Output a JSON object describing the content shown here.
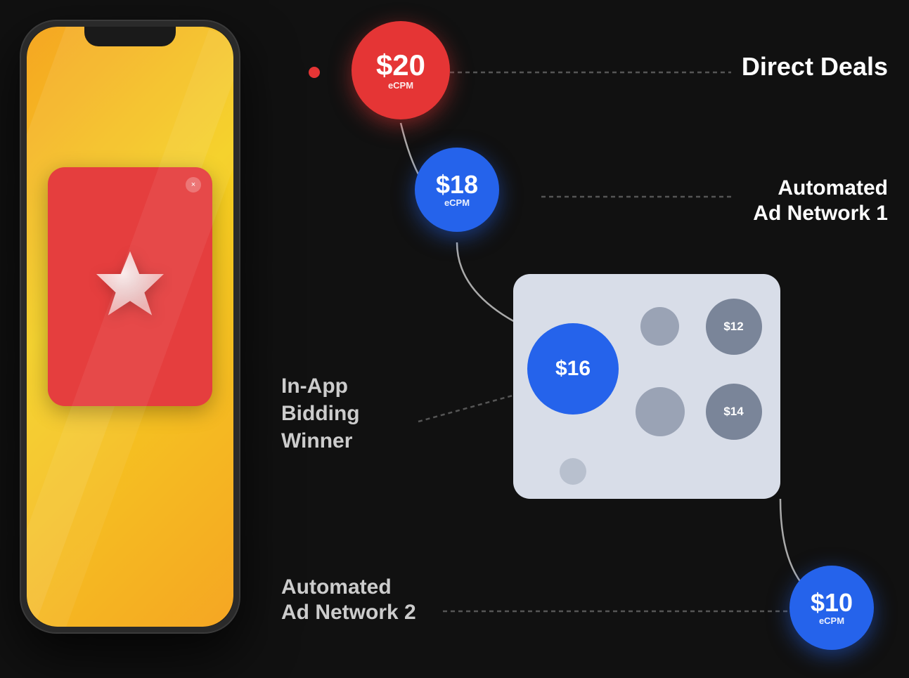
{
  "background": "#111111",
  "phone": {
    "ad_card": {
      "close_symbol": "×"
    }
  },
  "bubbles": {
    "red": {
      "value": "$20",
      "label": "eCPM",
      "size": 140,
      "color": "#e53535"
    },
    "blue_18": {
      "value": "$18",
      "label": "eCPM",
      "size": 120,
      "color": "#2563eb"
    },
    "blue_16": {
      "value": "$16",
      "size": 130,
      "color": "#2563eb"
    },
    "grey_14": {
      "value": "$14",
      "size": 80,
      "color": "#7a8599"
    },
    "grey_12": {
      "value": "$12",
      "size": 80,
      "color": "#7a8599"
    },
    "blue_10": {
      "value": "$10",
      "label": "eCPM",
      "size": 120,
      "color": "#2563eb"
    }
  },
  "labels": {
    "direct_deals": "Direct Deals",
    "automated_network_1_line1": "Automated",
    "automated_network_1_line2": "Ad Network 1",
    "in_app_bidding_line1": "In-App",
    "in_app_bidding_line2": "Bidding",
    "in_app_bidding_line3": "Winner",
    "automated_network_2_line1": "Automated",
    "automated_network_2_line2": "Ad Network 2"
  }
}
